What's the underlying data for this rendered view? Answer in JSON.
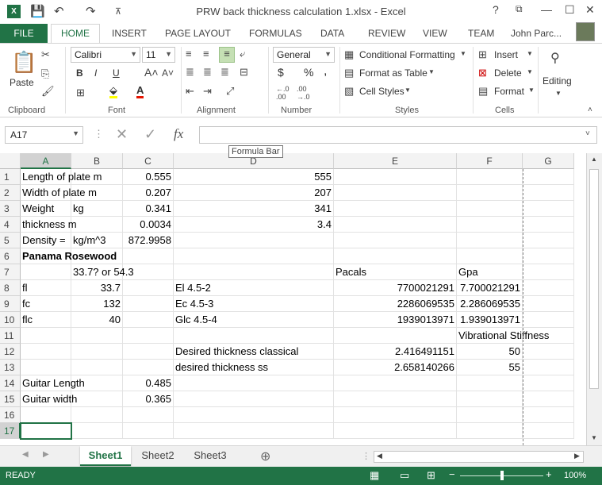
{
  "window": {
    "title": "PRW back thickness calculation 1.xlsx - Excel",
    "app_icon": "X",
    "buttons": {
      "help": "?",
      "restore_ribbon": "⧉",
      "minimize": "—",
      "maximize": "☐",
      "close": "✕"
    }
  },
  "quick_access": {
    "save": "💾",
    "undo": "↶",
    "redo": "↷",
    "customize": "⊼"
  },
  "ribbon_tabs": [
    "FILE",
    "HOME",
    "INSERT",
    "PAGE LAYOUT",
    "FORMULAS",
    "DATA",
    "REVIEW",
    "VIEW",
    "TEAM"
  ],
  "user": {
    "name": "John Parc..."
  },
  "ribbon": {
    "clipboard": {
      "paste": "Paste",
      "label": "Clipboard"
    },
    "font": {
      "family": "Calibri",
      "size": "11",
      "bold": "B",
      "italic": "I",
      "underline": "U",
      "label": "Font"
    },
    "alignment": {
      "label": "Alignment"
    },
    "number": {
      "format": "General",
      "currency": "$",
      "percent": "%",
      "comma": ",",
      "label": "Number"
    },
    "styles": {
      "conditional": "Conditional Formatting",
      "format_table": "Format as Table",
      "cell_styles": "Cell Styles",
      "label": "Styles"
    },
    "cells": {
      "insert": "Insert",
      "delete": "Delete",
      "format": "Format",
      "label": "Cells"
    },
    "editing": {
      "label": "Editing"
    }
  },
  "formula_bar": {
    "name_box": "A17",
    "fx": "fx",
    "tooltip": "Formula Bar",
    "value": ""
  },
  "columns": [
    "A",
    "B",
    "C",
    "D",
    "E",
    "F",
    "G"
  ],
  "rows": [
    {
      "num": "1",
      "cells": {
        "A": "Length of plate m",
        "C": "0.555",
        "D": "555"
      }
    },
    {
      "num": "2",
      "cells": {
        "A": "Width of plate m",
        "C": "0.207",
        "D": "207"
      }
    },
    {
      "num": "3",
      "cells": {
        "A": "Weight",
        "B": "kg",
        "C": "0.341",
        "D": "341"
      }
    },
    {
      "num": "4",
      "cells": {
        "A": "thickness m",
        "C": "0.0034",
        "D": "3.4"
      }
    },
    {
      "num": "5",
      "cells": {
        "A": "Density =",
        "B": "kg/m^3",
        "C": "872.9958"
      }
    },
    {
      "num": "6",
      "cells": {
        "A": "Panama Rosewood"
      }
    },
    {
      "num": "7",
      "cells": {
        "B": "33.7? or 54.3",
        "E": "Pacals",
        "F": "Gpa"
      }
    },
    {
      "num": "8",
      "cells": {
        "A": "fl",
        "B": "33.7",
        "D": "El 4.5-2",
        "E": "7700021291",
        "F": "7.700021291"
      }
    },
    {
      "num": "9",
      "cells": {
        "A": "fc",
        "B": "132",
        "D": "Ec 4.5-3",
        "E": "2286069535",
        "F": "2.286069535"
      }
    },
    {
      "num": "10",
      "cells": {
        "A": "flc",
        "B": "40",
        "D": "Glc 4.5-4",
        "E": "1939013971",
        "F": "1.939013971"
      }
    },
    {
      "num": "11",
      "cells": {
        "F": "Vibrational Stiffness"
      }
    },
    {
      "num": "12",
      "cells": {
        "D": "Desired thickness classical",
        "E": "2.416491151",
        "F": "50"
      }
    },
    {
      "num": "13",
      "cells": {
        "D": "desired thickness ss",
        "E": "2.658140266",
        "F": "55"
      }
    },
    {
      "num": "14",
      "cells": {
        "A": "Guitar Length",
        "C": "0.485"
      }
    },
    {
      "num": "15",
      "cells": {
        "A": "Guitar width",
        "C": "0.365"
      }
    },
    {
      "num": "16",
      "cells": {}
    },
    {
      "num": "17",
      "cells": {}
    }
  ],
  "sheets": [
    "Sheet1",
    "Sheet2",
    "Sheet3"
  ],
  "new_sheet": "⊕",
  "status": {
    "text": "READY",
    "zoom": "100%",
    "zoom_out": "−",
    "zoom_in": "+"
  }
}
